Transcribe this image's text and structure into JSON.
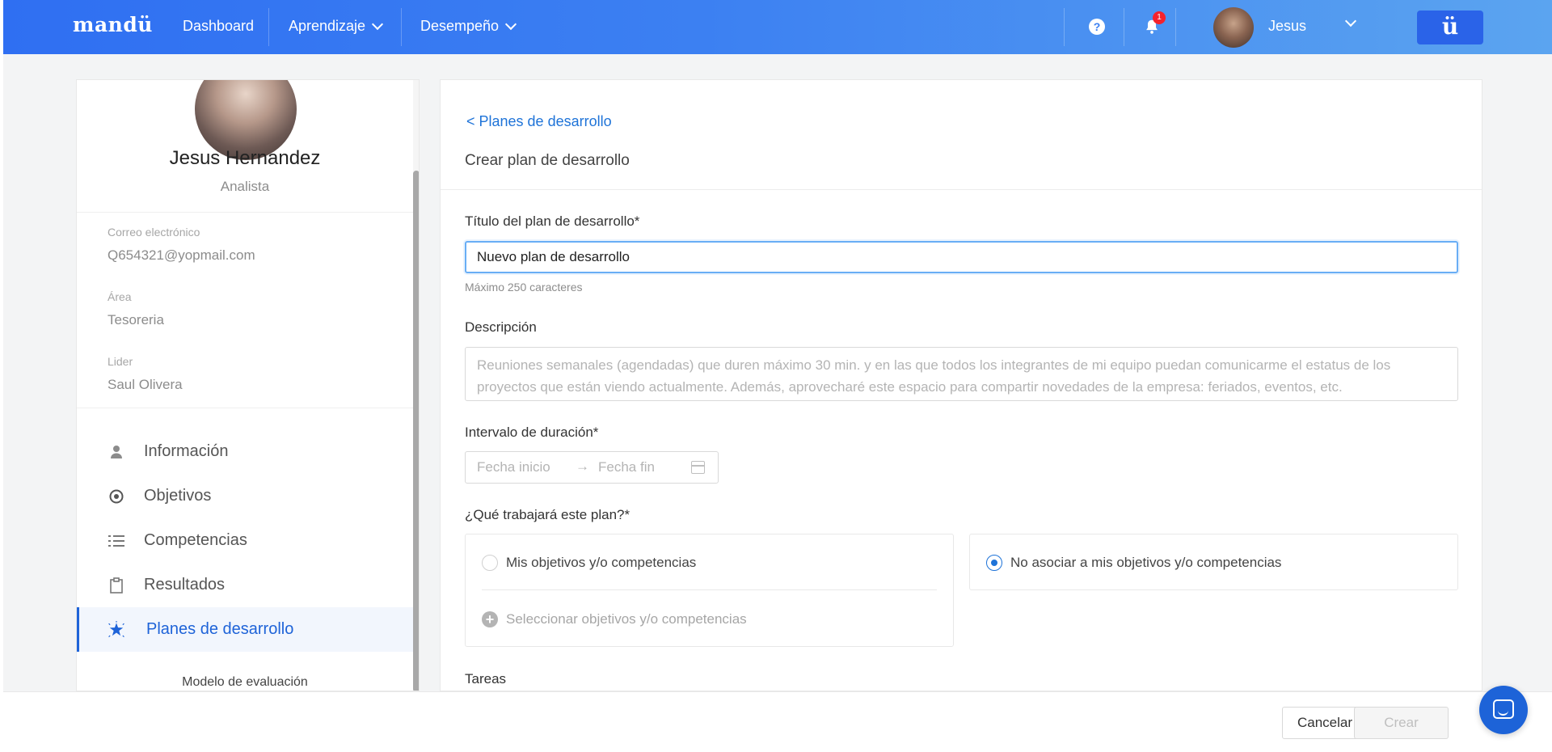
{
  "topbar": {
    "logo": "mandü",
    "nav": [
      {
        "label": "Dashboard",
        "has_dropdown": false
      },
      {
        "label": "Aprendizaje",
        "has_dropdown": true
      },
      {
        "label": "Desempeño",
        "has_dropdown": true
      }
    ],
    "help_icon": "question-circle-icon",
    "help_glyph": "?",
    "bell_icon": "bell-icon",
    "notification_count": "1",
    "user_name": "Jesus",
    "brand_button": "ü",
    "gradient_colors": [
      "#2f6ff2",
      "#5ba4f0"
    ]
  },
  "profile": {
    "name": "Jesus Hernandez",
    "role": "Analista",
    "fields": [
      {
        "label": "Correo electrónico",
        "value": "Q654321@yopmail.com"
      },
      {
        "label": "Área",
        "value": "Tesoreria"
      },
      {
        "label": "Lider",
        "value": "Saul Olivera"
      }
    ]
  },
  "sidebar": {
    "items": [
      {
        "label": "Información",
        "icon": "user-icon",
        "active": false
      },
      {
        "label": "Objetivos",
        "icon": "target-icon",
        "active": false
      },
      {
        "label": "Competencias",
        "icon": "list-icon",
        "active": false
      },
      {
        "label": "Resultados",
        "icon": "clipboard-icon",
        "active": false
      },
      {
        "label": "Planes de desarrollo",
        "icon": "star-burst-icon",
        "active": true
      }
    ],
    "footer_label": "Modelo de evaluación",
    "active_color": "#1e63d8"
  },
  "form": {
    "back_link": "< Planes de desarrollo",
    "title": "Crear plan de desarrollo",
    "title_label": "Título del plan de desarrollo*",
    "title_value": "Nuevo plan de desarrollo",
    "title_hint": "Máximo 250 caracteres",
    "description_label": "Descripción",
    "description_placeholder_line1": "Reuniones semanales (agendadas) que duren máximo 30 min. y en las que todos los integrantes de mi equipo puedan comunicarme el estatus de los",
    "description_placeholder_line2": "proyectos que están viendo actualmente. Además, aprovecharé este espacio para compartir novedades de la empresa: feriados, eventos, etc.",
    "interval_label": "Intervalo de duración*",
    "date_start_placeholder": "Fecha inicio",
    "date_arrow": "→",
    "date_end_placeholder": "Fecha fin",
    "scope_label": "¿Qué trabajará este plan?*",
    "option_own": "Mis objetivos y/o competencias",
    "option_select": "Seleccionar objetivos y/o competencias",
    "option_none": "No asociar a mis objetivos y/o competencias",
    "selected_option": "none",
    "tasks_label": "Tareas"
  },
  "footer": {
    "cancel_label": "Cancelar",
    "create_label": "Crear"
  },
  "chat_button_icon": "chat-icon"
}
